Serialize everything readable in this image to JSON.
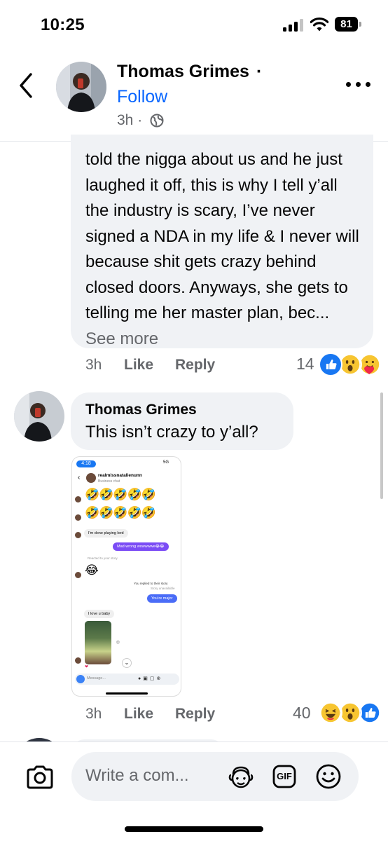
{
  "status_bar": {
    "time": "10:25",
    "battery": "81",
    "icons": [
      "signal-icon",
      "wifi-icon",
      "battery-icon"
    ]
  },
  "header": {
    "name": "Thomas Grimes",
    "name_separator": "·",
    "follow_label": "Follow",
    "time": "3h ·",
    "icons": [
      "back-chevron-icon",
      "globe-icon",
      "more-dots-icon"
    ]
  },
  "comment1": {
    "text": "told the nigga about us and he just laughed it off, this is why I tell y’all the industry is scary, I’ve never signed a NDA in my life & I never will because shit gets crazy behind closed doors. Anyways, she gets to telling me her master plan, bec...",
    "see_more": "See more",
    "time": "3h",
    "like_label": "Like",
    "reply_label": "Reply",
    "reaction_count": "14",
    "reactions": [
      "like",
      "wow",
      "care"
    ]
  },
  "comment2": {
    "author": "Thomas Grimes",
    "text": "This isn’t crazy to y’all?",
    "time": "3h",
    "like_label": "Like",
    "reply_label": "Reply",
    "reaction_count": "40",
    "reactions": [
      "haha",
      "wow",
      "like"
    ],
    "attachment": {
      "time": "4:18",
      "network": "5G",
      "username": "realmissnatalienunn",
      "subtitle": "Business chat",
      "msg_done": "I'm done playing lord",
      "msg_mad": "Mad wrong wowwwwe😂😂",
      "reacted": "Reacted to your story",
      "replied": "You replied to their story",
      "unavailable": "Story unavailable",
      "msg_major": "You're major",
      "msg_love": "I love u baby",
      "message_placeholder": "Message..."
    }
  },
  "composer": {
    "placeholder": "Write a com...",
    "gif_label": "GIF",
    "icons": [
      "camera-icon",
      "avatar-sticker-icon",
      "gif-icon",
      "emoji-icon"
    ]
  },
  "colors": {
    "accent": "#0866ff",
    "bubble": "#f0f2f5",
    "secondary_text": "#65676b"
  }
}
